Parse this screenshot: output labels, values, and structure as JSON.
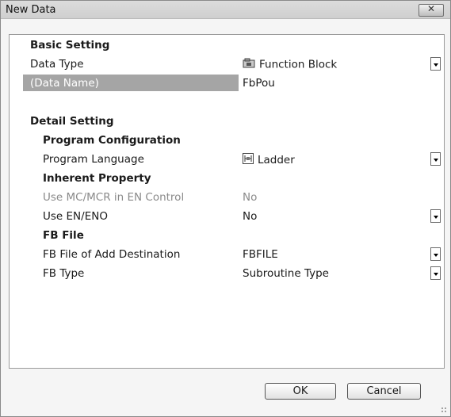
{
  "window": {
    "title": "New Data",
    "close_glyph": "✕"
  },
  "properties": [
    {
      "label": "Basic Setting",
      "kind": "category",
      "level": 1
    },
    {
      "label": "Data Type",
      "value": "Function Block",
      "icon": "function-block-icon",
      "dropdown": true,
      "level": 1
    },
    {
      "label": "(Data Name)",
      "value": "FbPou",
      "selected": true,
      "level": 1
    },
    {
      "label": "",
      "kind": "spacer"
    },
    {
      "label": "Detail Setting",
      "kind": "category",
      "level": 1
    },
    {
      "label": "Program Configuration",
      "kind": "category",
      "level": 2
    },
    {
      "label": "Program Language",
      "value": "Ladder",
      "icon": "ladder-icon",
      "dropdown": true,
      "level": 2
    },
    {
      "label": "Inherent Property",
      "kind": "category",
      "level": 2
    },
    {
      "label": "Use MC/MCR in EN Control",
      "value": "No",
      "disabled": true,
      "level": 2
    },
    {
      "label": "Use EN/ENO",
      "value": "No",
      "dropdown": true,
      "level": 2
    },
    {
      "label": "FB File",
      "kind": "category",
      "level": 2
    },
    {
      "label": "FB File of Add Destination",
      "value": "FBFILE",
      "dropdown": true,
      "level": 2
    },
    {
      "label": "FB Type",
      "value": "Subroutine Type",
      "dropdown": true,
      "level": 2
    }
  ],
  "buttons": {
    "ok": "OK",
    "cancel": "Cancel"
  }
}
